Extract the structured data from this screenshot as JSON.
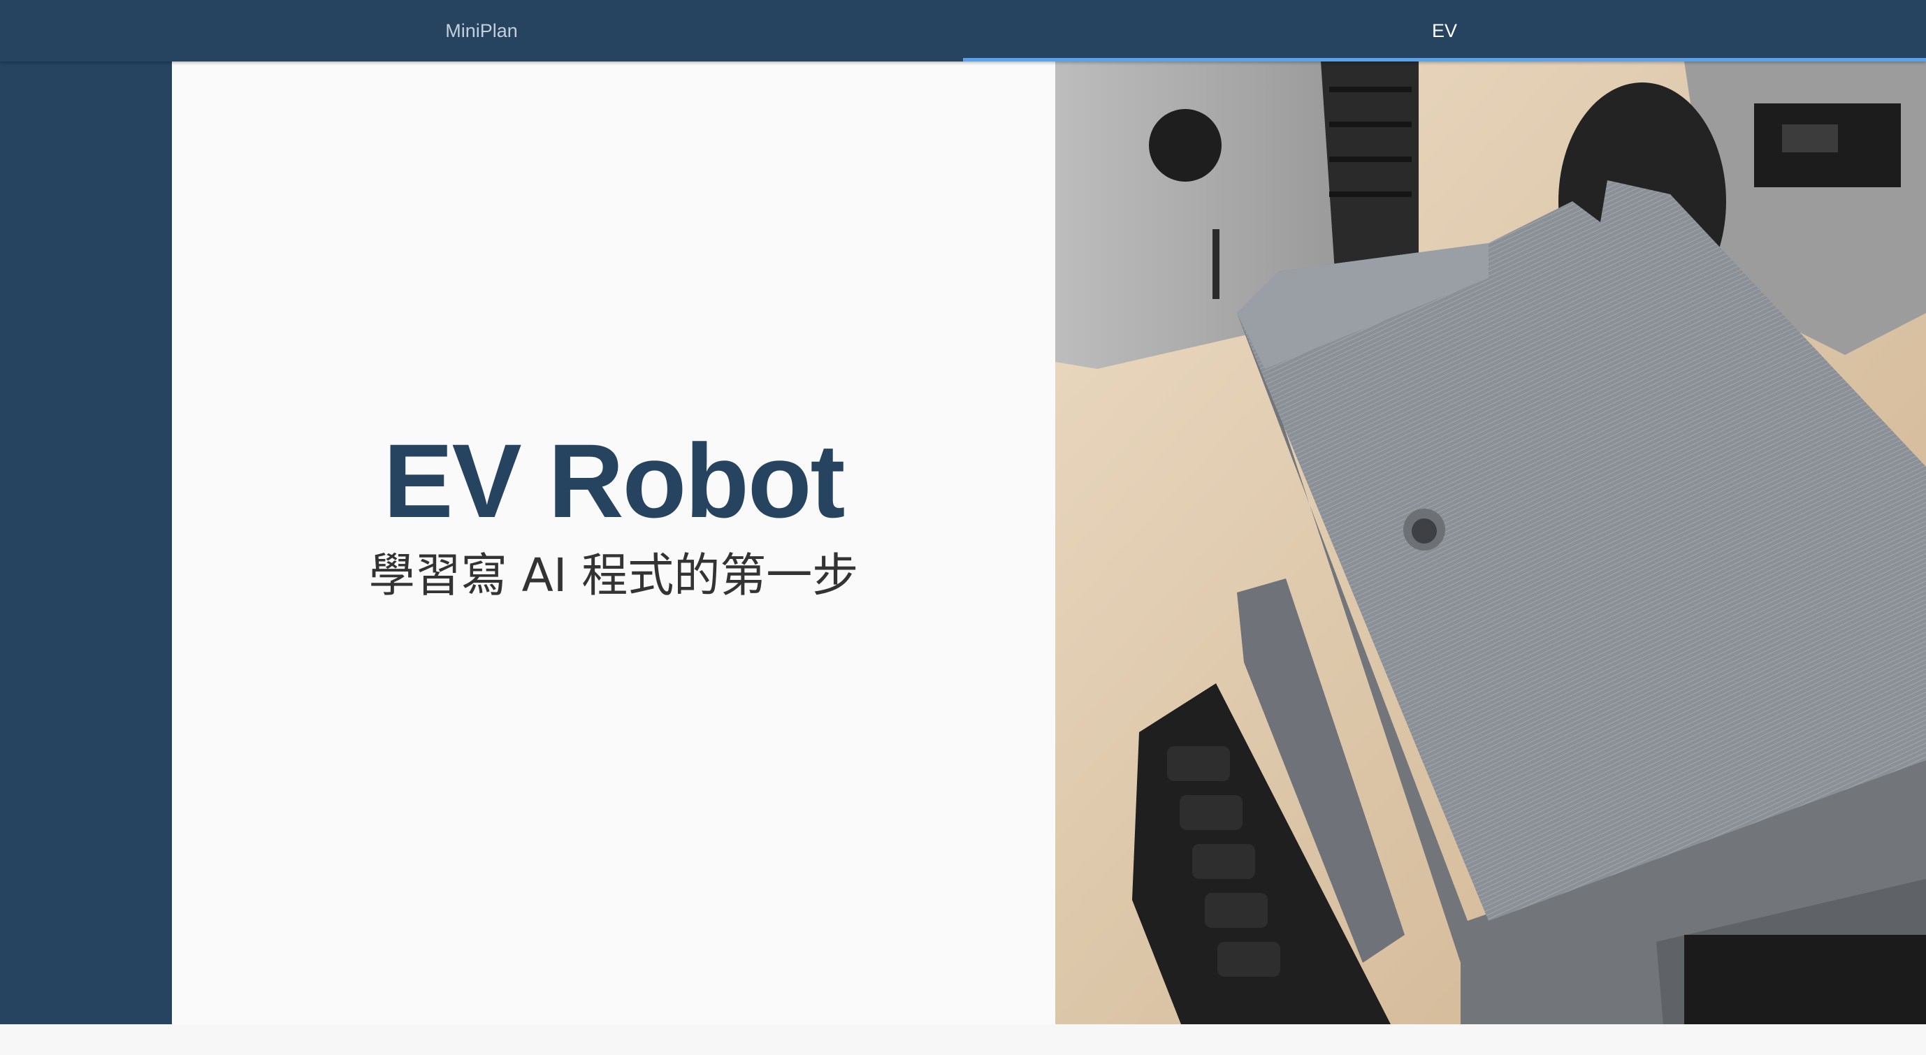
{
  "tabs": [
    {
      "label": "MiniPlan",
      "active": false
    },
    {
      "label": "EV",
      "active": true
    }
  ],
  "slide": {
    "title": "EV Robot",
    "subtitle": "學習寫 AI 程式的第一步"
  },
  "photo": {
    "icon": "robot-photo-icon"
  },
  "colors": {
    "accent": "#26435f",
    "tab_indicator": "#5aa2ea",
    "background": "#fafafa"
  }
}
